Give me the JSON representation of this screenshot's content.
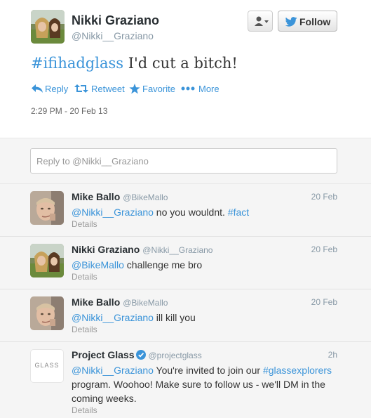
{
  "tweet": {
    "name": "Nikki Graziano",
    "handle": "@Nikki__Graziano",
    "hashtag": "#ifihadglass",
    "text": " I'd cut a bitch!",
    "timestamp": "2:29 PM - 20 Feb 13",
    "actions": {
      "reply": "Reply",
      "retweet": "Retweet",
      "favorite": "Favorite",
      "more": "More"
    },
    "follow_label": "Follow"
  },
  "reply_box": {
    "placeholder": "Reply to @Nikki__Graziano"
  },
  "replies": [
    {
      "name": "Mike Ballo",
      "handle": "@BikeMallo",
      "date": "20 Feb",
      "mention": "@Nikki__Graziano",
      "text": " no you wouldnt. ",
      "tag": "#fact",
      "details": "Details"
    },
    {
      "name": "Nikki Graziano",
      "handle": "@Nikki__Graziano",
      "date": "20 Feb",
      "mention": "@BikeMallo",
      "text": " challenge me bro",
      "details": "Details"
    },
    {
      "name": "Mike Ballo",
      "handle": "@BikeMallo",
      "date": "20 Feb",
      "mention": "@Nikki__Graziano",
      "text": " ill kill you",
      "details": "Details"
    },
    {
      "name": "Project Glass",
      "handle": "@projectglass",
      "date": "2h",
      "mention": "@Nikki__Graziano",
      "text_before_tag": " You're invited to join our ",
      "tag": "#glassexplorers",
      "text_after_tag": " program. Woohoo! Make sure to follow us - we'll DM in the coming weeks.",
      "avatar_text": "GLASS",
      "details": "Details"
    }
  ]
}
